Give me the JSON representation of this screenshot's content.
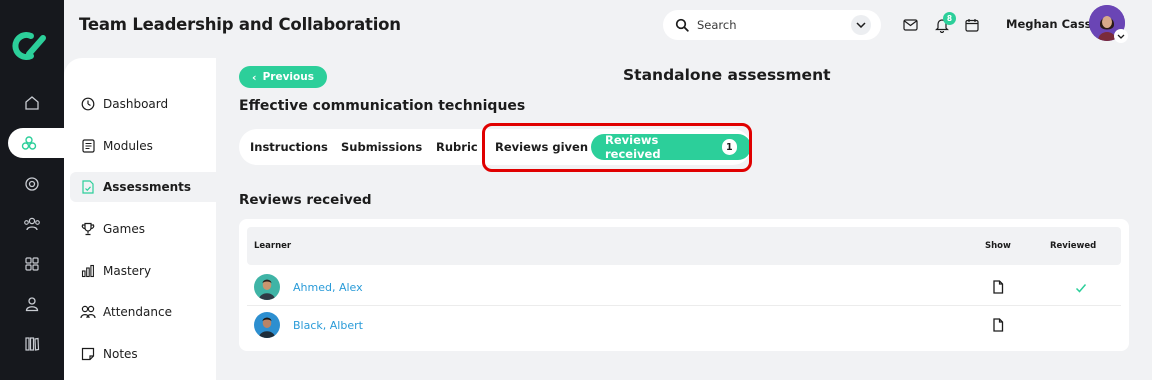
{
  "header": {
    "title": "Team Leadership and Collaboration",
    "search_placeholder": "Search",
    "notification_count": "8",
    "user_name": "Meghan Cass"
  },
  "rail": {
    "icons": [
      "home-icon",
      "assessments-icon",
      "target-icon",
      "people-icon",
      "grid-icon",
      "person-icon",
      "library-icon"
    ],
    "active": "assessments-icon"
  },
  "sidebar": {
    "items": [
      {
        "label": "Dashboard",
        "icon": "dashboard-icon"
      },
      {
        "label": "Modules",
        "icon": "modules-icon"
      },
      {
        "label": "Assessments",
        "icon": "assessments-icon",
        "active": true
      },
      {
        "label": "Games",
        "icon": "trophy-icon"
      },
      {
        "label": "Mastery",
        "icon": "chart-icon"
      },
      {
        "label": "Attendance",
        "icon": "attendance-icon"
      },
      {
        "label": "Notes",
        "icon": "notes-icon"
      }
    ]
  },
  "main": {
    "previous_label": "Previous",
    "assessment_title": "Standalone assessment",
    "subtitle": "Effective communication techniques",
    "tabs": [
      {
        "label": "Instructions"
      },
      {
        "label": "Submissions"
      },
      {
        "label": "Rubric"
      },
      {
        "label": "Reviews given"
      },
      {
        "label": "Reviews received",
        "count": "1",
        "active": true
      }
    ],
    "section_title": "Reviews received",
    "table": {
      "columns": [
        "Learner",
        "Show",
        "Reviewed"
      ],
      "rows": [
        {
          "name": "Ahmed, Alex",
          "reviewed": true
        },
        {
          "name": "Black, Albert",
          "reviewed": false
        }
      ]
    }
  },
  "colors": {
    "accent": "#2ccf9a",
    "rail": "#16181d",
    "link": "#2a9bd8",
    "highlight": "#e00000"
  }
}
